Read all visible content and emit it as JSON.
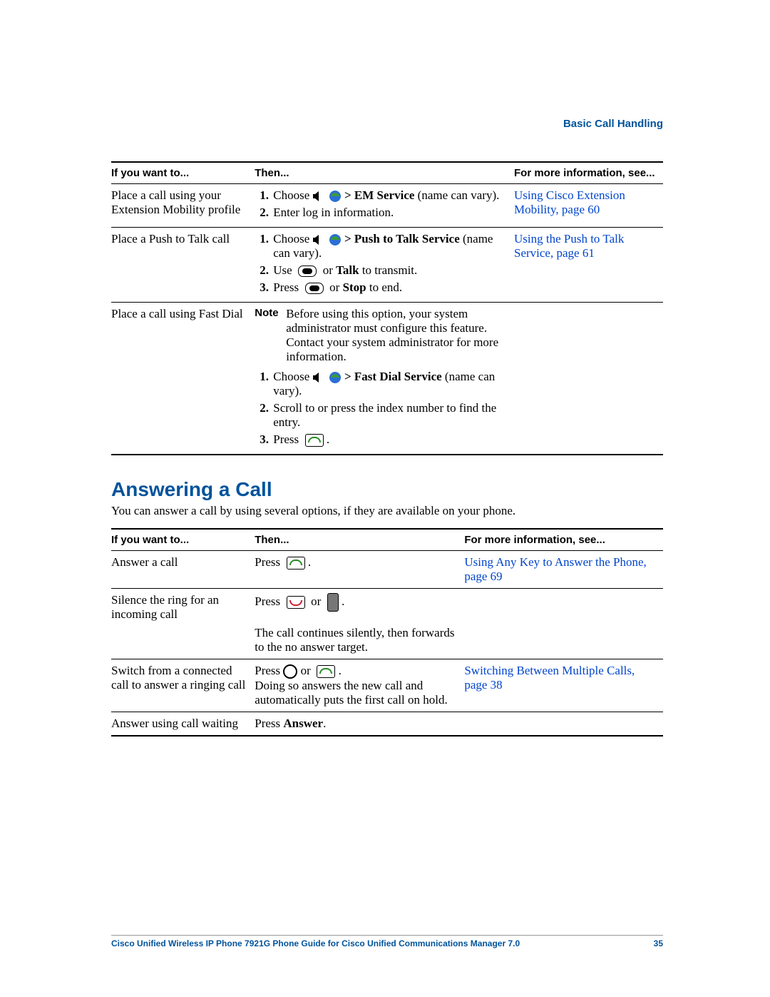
{
  "chapter": "Basic Call Handling",
  "table1": {
    "headers": {
      "a": "If you want to...",
      "b": "Then...",
      "c": "For more information, see..."
    },
    "rows": [
      {
        "want": "Place a call using your Extension Mobility profile",
        "then_html": "<ol class='steps'><li>Choose <svg class='icon icon-speaker' viewBox='0 0 18 14'><path d='M1 4h3l5-4v14l-5-4H1z' fill='#000'/></svg> <svg class='icon icon-globe' viewBox='0 0 18 18'><circle cx='9' cy='9' r='8' fill='#2a6fd6'/><path d='M2 9c2-3 5-5 7-5s5 2 7 5' fill='#3c9a3c'/></svg> <b>&gt; EM Service</b> (name can vary).</li><li>Enter log in information.</li></ol>",
        "link_text": "Using Cisco Extension Mobility, page 60"
      },
      {
        "want": "Place a Push to Talk call",
        "then_html": "<ol class='steps'><li>Choose <svg class='icon icon-speaker' viewBox='0 0 18 14'><path d='M1 4h3l5-4v14l-5-4H1z' fill='#000'/></svg> <svg class='icon icon-globe' viewBox='0 0 18 18'><circle cx='9' cy='9' r='8' fill='#2a6fd6'/><path d='M2 9c2-3 5-5 7-5s5 2 7 5' fill='#3c9a3c'/></svg> <b>&gt; Push to Talk Service</b> (name can vary).</li><li>Use &nbsp;<span class='icon-pill'></span>&nbsp; or <b>Talk</b> to transmit.</li><li>Press &nbsp;<span class='icon-pill'></span>&nbsp; or <b>Stop</b> to end.</li></ol>",
        "link_text": "Using the Push to Talk Service, page 61"
      },
      {
        "want": "Place a call using Fast Dial",
        "then_html": "<div class='note-row'><span class='note-label'>Note</span><span>Before using this option, your system administrator must configure this feature. Contact your system administrator for more information.</span></div><ol class='steps'><li>Choose <svg class='icon icon-speaker' viewBox='0 0 18 14'><path d='M1 4h3l5-4v14l-5-4H1z' fill='#000'/></svg> <svg class='icon icon-globe' viewBox='0 0 18 18'><circle cx='9' cy='9' r='8' fill='#2a6fd6'/><path d='M2 9c2-3 5-5 7-5s5 2 7 5' fill='#3c9a3c'/></svg> <b>&gt; Fast Dial Service</b> (name can vary).</li><li>Scroll to or press the index number to find the entry.</li><li>Press &nbsp;<span class='icon-ans'></span> .</li></ol>",
        "link_text": ""
      }
    ]
  },
  "section": {
    "title": "Answering a Call",
    "intro": "You can answer a call by using several options, if they are available on your phone."
  },
  "table2": {
    "headers": {
      "a": "If you want to...",
      "b": "Then...",
      "c": "For more information, see..."
    },
    "rows": [
      {
        "want": "Answer a call",
        "then_html": "Press &nbsp;<span class='icon-ans'></span> .",
        "link_text": "Using Any Key to Answer the Phone, page 69"
      },
      {
        "want": "Silence the ring for an incoming call",
        "then_html": "Press &nbsp;<span class='icon-end'></span>&nbsp; or &nbsp;<span class='icon-vol'></span> .<br><br>The call continues silently, then forwards to the no answer target.",
        "link_text": ""
      },
      {
        "want": "Switch from a connected call to answer a ringing call",
        "then_html": "Press <span class='icon-ring'></span> or &nbsp;<span class='icon-ans'></span> .<br>Doing so answers the new call and automatically puts the first call on hold.",
        "link_text": "Switching Between Multiple Calls, page 38"
      },
      {
        "want": "Answer using call waiting",
        "then_html": "Press <b>Answer</b>.",
        "link_text": ""
      }
    ]
  },
  "footer": {
    "title": "Cisco Unified Wireless IP Phone 7921G Phone Guide for Cisco Unified Communications Manager 7.0",
    "page": "35"
  }
}
